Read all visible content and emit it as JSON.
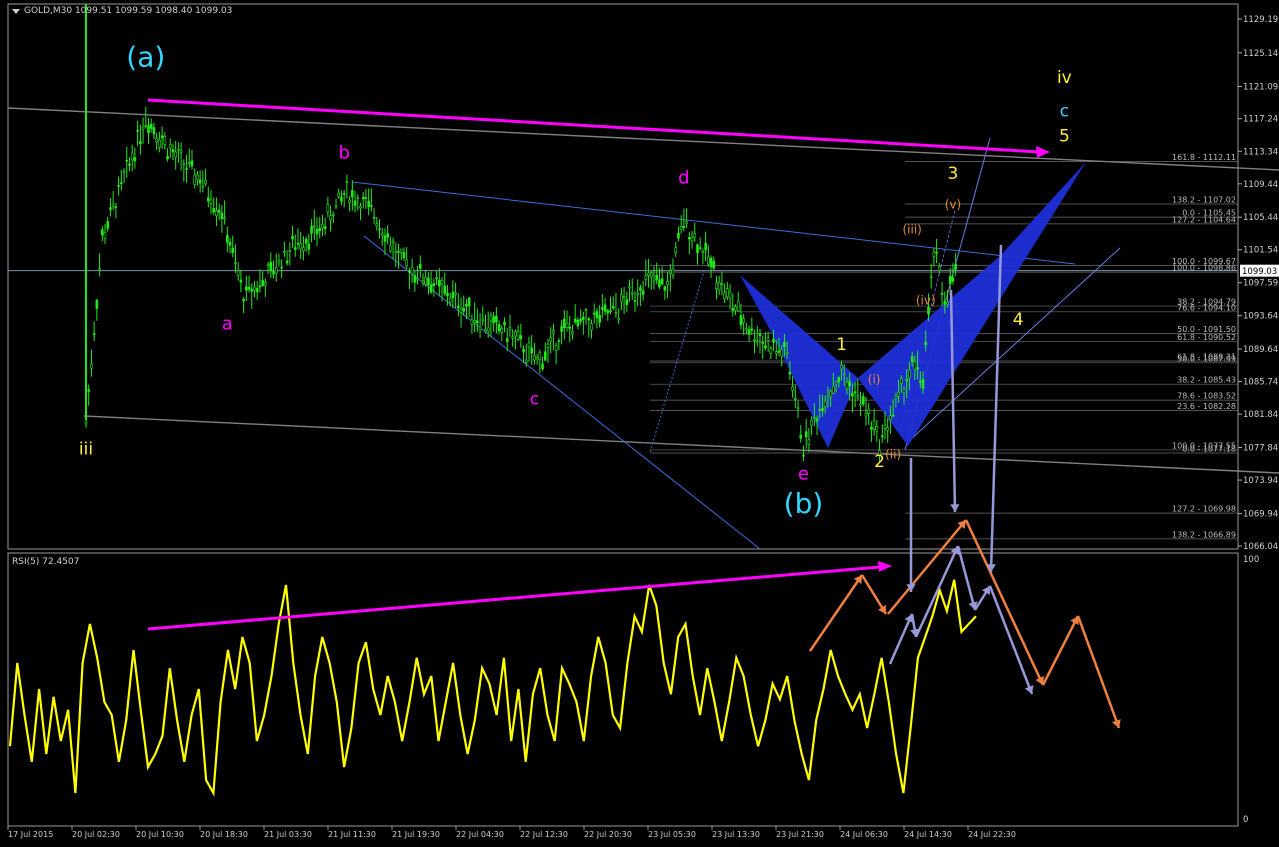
{
  "header": {
    "symbol_line": "GOLD,M30  1099.51 1099.59 1098.40 1099.03",
    "rsi_line": "RSI(5) 72.4507"
  },
  "colors": {
    "background": "#000000",
    "candle": "#22e81a",
    "rsi": "#ffff00",
    "magenta": "#ff00ff",
    "cyan": "#33d6ff",
    "yellow_label": "#ffee33",
    "orange_label": "#e08a3c",
    "orange_arrow": "#f08040",
    "lavender_arrow": "#9898d8",
    "blue_pattern": "#1f2fd8",
    "grid_text": "#bbbbbb"
  },
  "chart_data": [
    {
      "type": "candlestick",
      "title": "GOLD,M30",
      "ylim": [
        1066.04,
        1131.0
      ],
      "y_ticks": [
        1129.19,
        1125.14,
        1121.09,
        1117.24,
        1113.34,
        1109.44,
        1105.44,
        1101.54,
        1097.59,
        1093.64,
        1089.64,
        1085.74,
        1081.84,
        1077.84,
        1073.94,
        1069.94,
        1066.04
      ],
      "current_price": 1099.03,
      "x_ticks": [
        "17 Jul 2015",
        "20 Jul 02:30",
        "20 Jul 10:30",
        "20 Jul 18:30",
        "21 Jul 03:30",
        "21 Jul 11:30",
        "21 Jul 19:30",
        "22 Jul 04:30",
        "22 Jul 12:30",
        "22 Jul 20:30",
        "23 Jul 05:30",
        "23 Jul 13:30",
        "23 Jul 21:30",
        "24 Jul 06:30",
        "24 Jul 14:30",
        "24 Jul 22:30"
      ],
      "price_path": [
        {
          "bar": 0,
          "price": 1081.0
        },
        {
          "bar": 6,
          "price": 1103.0
        },
        {
          "bar": 14,
          "price": 1110.0
        },
        {
          "bar": 22,
          "price": 1117.5
        },
        {
          "bar": 32,
          "price": 1113.0
        },
        {
          "bar": 42,
          "price": 1110.0
        },
        {
          "bar": 50,
          "price": 1106.0
        },
        {
          "bar": 58,
          "price": 1096.0
        },
        {
          "bar": 66,
          "price": 1098.0
        },
        {
          "bar": 76,
          "price": 1102.0
        },
        {
          "bar": 86,
          "price": 1104.0
        },
        {
          "bar": 96,
          "price": 1108.5
        },
        {
          "bar": 106,
          "price": 1106.0
        },
        {
          "bar": 116,
          "price": 1100.0
        },
        {
          "bar": 126,
          "price": 1098.0
        },
        {
          "bar": 136,
          "price": 1095.5
        },
        {
          "bar": 146,
          "price": 1093.0
        },
        {
          "bar": 156,
          "price": 1091.5
        },
        {
          "bar": 166,
          "price": 1088.0
        },
        {
          "bar": 176,
          "price": 1092.0
        },
        {
          "bar": 186,
          "price": 1093.0
        },
        {
          "bar": 196,
          "price": 1094.5
        },
        {
          "bar": 206,
          "price": 1098.0
        },
        {
          "bar": 214,
          "price": 1097.0
        },
        {
          "bar": 220,
          "price": 1105.0
        },
        {
          "bar": 228,
          "price": 1101.0
        },
        {
          "bar": 236,
          "price": 1096.0
        },
        {
          "bar": 244,
          "price": 1092.0
        },
        {
          "bar": 252,
          "price": 1090.0
        },
        {
          "bar": 258,
          "price": 1089.0
        },
        {
          "bar": 264,
          "price": 1078.0
        },
        {
          "bar": 272,
          "price": 1084.0
        },
        {
          "bar": 278,
          "price": 1086.5
        },
        {
          "bar": 286,
          "price": 1083.0
        },
        {
          "bar": 292,
          "price": 1078.5
        },
        {
          "bar": 298,
          "price": 1083.0
        },
        {
          "bar": 304,
          "price": 1087.5
        },
        {
          "bar": 308,
          "price": 1086.0
        },
        {
          "bar": 312,
          "price": 1101.5
        },
        {
          "bar": 316,
          "price": 1095.5
        },
        {
          "bar": 320,
          "price": 1099.0
        }
      ],
      "wave_labels": [
        {
          "text": "(a)",
          "bar": 22,
          "price": 1123.5,
          "color": "cyan"
        },
        {
          "text": "iii",
          "bar": 0,
          "price": 1077.0,
          "color": "yellow_label"
        },
        {
          "text": "a",
          "bar": 52,
          "price": 1092.0,
          "color": "magenta"
        },
        {
          "text": "b",
          "bar": 95,
          "price": 1112.5,
          "color": "magenta"
        },
        {
          "text": "c",
          "bar": 165,
          "price": 1083.0,
          "color": "magenta"
        },
        {
          "text": "d",
          "bar": 220,
          "price": 1109.5,
          "color": "magenta"
        },
        {
          "text": "e",
          "bar": 264,
          "price": 1074.0,
          "color": "magenta"
        },
        {
          "text": "(b)",
          "bar": 264,
          "price": 1070.0,
          "color": "cyan"
        },
        {
          "text": "1",
          "bar": 278,
          "price": 1089.5,
          "color": "yellow_label"
        },
        {
          "text": "2",
          "bar": 292,
          "price": 1075.5,
          "color": "yellow_label"
        },
        {
          "text": "3",
          "bar": 319,
          "price": 1110.0,
          "color": "yellow_label"
        },
        {
          "text": "4",
          "bar": 343,
          "price": 1092.5,
          "color": "yellow_label"
        },
        {
          "text": "iv",
          "bar": 360,
          "price": 1121.5,
          "color": "yellow_label"
        },
        {
          "text": "c",
          "bar": 360,
          "price": 1117.5,
          "color": "cyan"
        },
        {
          "text": "5",
          "bar": 360,
          "price": 1114.5,
          "color": "yellow_label"
        },
        {
          "text": "(i)",
          "bar": 290,
          "price": 1085.5,
          "color": "orange_label"
        },
        {
          "text": "(ii)",
          "bar": 297,
          "price": 1076.5,
          "color": "orange_label"
        },
        {
          "text": "(iii)",
          "bar": 304,
          "price": 1103.5,
          "color": "orange_label"
        },
        {
          "text": "(iv)",
          "bar": 309,
          "price": 1095.0,
          "color": "orange_label"
        },
        {
          "text": "(v)",
          "bar": 319,
          "price": 1106.5,
          "color": "orange_label"
        }
      ],
      "fib_levels": [
        {
          "label": "161.8 - 1112.11",
          "price": 1112.11
        },
        {
          "label": "138.2 - 1107.02",
          "price": 1107.02
        },
        {
          "label": "0.0 - 1105.45",
          "price": 1105.45
        },
        {
          "label": "127.2 - 1104.64",
          "price": 1104.64
        },
        {
          "label": "100.0 - 1099.67",
          "price": 1099.67
        },
        {
          "label": "100.0 - 1098.86",
          "price": 1098.86
        },
        {
          "label": "38.2 - 1094.79",
          "price": 1094.79
        },
        {
          "label": "76.6 - 1094.10",
          "price": 1094.1
        },
        {
          "label": "50.0 - 1091.50",
          "price": 1091.5
        },
        {
          "label": "61.8 - 1090.52",
          "price": 1090.52
        },
        {
          "label": "61.8 - 1088.21",
          "price": 1088.21
        },
        {
          "label": "50.0 - 1087.99",
          "price": 1087.99
        },
        {
          "label": "38.2 - 1085.43",
          "price": 1085.43
        },
        {
          "label": "78.6 - 1083.52",
          "price": 1083.52
        },
        {
          "label": "23.6 - 1082.28",
          "price": 1082.28
        },
        {
          "label": "100.0 - 1077.55",
          "price": 1077.55
        },
        {
          "label": "0.0 - 1077.18",
          "price": 1077.18
        },
        {
          "label": "127.2 - 1069.98",
          "price": 1069.98
        },
        {
          "label": "138.2 - 1066.89",
          "price": 1066.89
        }
      ]
    },
    {
      "type": "line",
      "title": "RSI(5) 72.4507",
      "ylim": [
        0,
        100
      ],
      "y_ticks": [
        100,
        0
      ],
      "series": [
        {
          "name": "RSI(5)",
          "values": [
            28,
            60,
            40,
            22,
            50,
            25,
            47,
            30,
            42,
            10,
            60,
            75,
            62,
            45,
            40,
            22,
            38,
            65,
            42,
            20,
            25,
            32,
            58,
            38,
            22,
            40,
            50,
            15,
            10,
            45,
            65,
            50,
            70,
            60,
            30,
            40,
            55,
            75,
            90,
            60,
            40,
            25,
            55,
            70,
            60,
            45,
            20,
            35,
            60,
            68,
            50,
            40,
            55,
            45,
            30,
            45,
            62,
            48,
            55,
            30,
            45,
            60,
            40,
            25,
            38,
            58,
            52,
            40,
            62,
            30,
            50,
            22,
            48,
            58,
            40,
            30,
            58,
            52,
            45,
            30,
            55,
            70,
            60,
            40,
            35,
            60,
            78,
            72,
            90,
            82,
            60,
            48,
            70,
            75,
            55,
            40,
            58,
            45,
            30,
            45,
            62,
            55,
            40,
            28,
            38,
            52,
            46,
            55,
            38,
            25,
            15,
            38,
            50,
            65,
            55,
            48,
            42,
            48,
            35,
            48,
            62,
            45,
            25,
            10,
            35,
            62,
            70,
            78,
            88,
            80,
            92,
            72,
            75,
            78
          ]
        }
      ]
    }
  ]
}
